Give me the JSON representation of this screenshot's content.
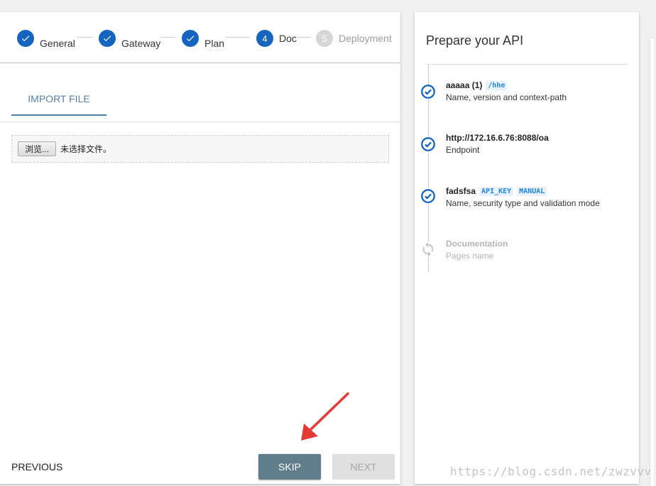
{
  "stepper": {
    "steps": [
      {
        "label": "General",
        "marker": "check",
        "state": "done"
      },
      {
        "label": "Gateway",
        "marker": "check",
        "state": "done"
      },
      {
        "label": "Plan",
        "marker": "check",
        "state": "done"
      },
      {
        "label": "Doc",
        "marker": "4",
        "state": "active"
      },
      {
        "label": "Deployment",
        "marker": "5",
        "state": "inactive"
      }
    ]
  },
  "tabs": {
    "import_file": "IMPORT FILE"
  },
  "file_input": {
    "browse_label": "浏览...",
    "status_text": "未选择文件。"
  },
  "actions": {
    "previous": "PREVIOUS",
    "skip": "SKIP",
    "next": "NEXT"
  },
  "summary": {
    "title": "Prepare your API",
    "items": [
      {
        "title": "aaaaa (1)",
        "tags": [
          "/hhe"
        ],
        "subtitle": "Name, version and context-path",
        "state": "done",
        "icon": "check-circle-icon"
      },
      {
        "title": "http://172.16.6.76:8088/oa",
        "tags": [],
        "subtitle": "Endpoint",
        "state": "done",
        "icon": "check-circle-icon"
      },
      {
        "title": "fadsfsa",
        "tags": [
          "API_KEY",
          "MANUAL"
        ],
        "subtitle": "Name, security type and validation mode",
        "state": "done",
        "icon": "check-circle-icon"
      },
      {
        "title": "Documentation",
        "tags": [],
        "subtitle": "Pages name",
        "state": "pending",
        "icon": "sync-icon"
      }
    ]
  },
  "watermark": "https://blog.csdn.net/zwzvvv",
  "colors": {
    "primary": "#1565c0",
    "skip_button": "#607d8b",
    "tag_text": "#1e88e5",
    "annotation_arrow": "#e53935"
  }
}
